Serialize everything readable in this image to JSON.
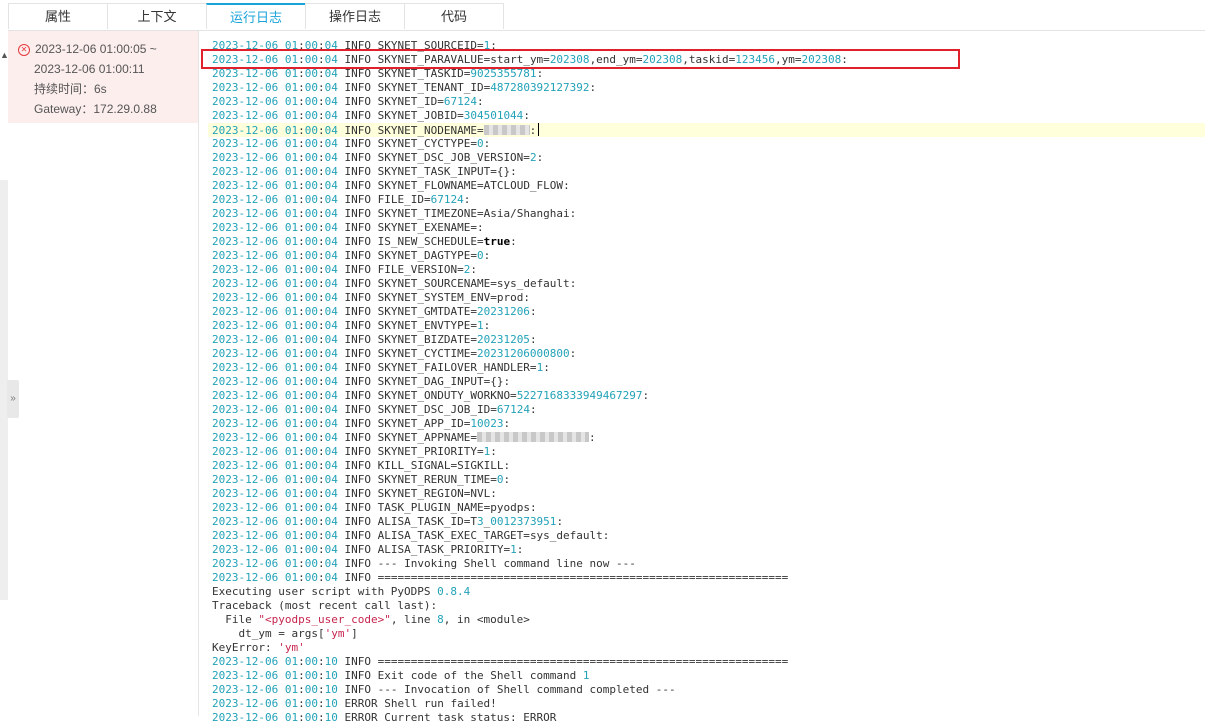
{
  "tabs": [
    "属性",
    "上下文",
    "运行日志",
    "操作日志",
    "代码"
  ],
  "active_tab": "运行日志",
  "run": {
    "start": "2023-12-06 01:00:05 ~",
    "end": "2023-12-06 01:00:11",
    "duration": "持续时间：6s",
    "gateway": "Gateway：172.29.0.88",
    "status_icon": "error-circle-icon"
  },
  "collapse_label": "»",
  "colors": {
    "accent": "#1aa3d9",
    "highlight_box": "#e0202a",
    "timestamp": "#22a2b8",
    "run_panel_bg": "#fdeeee"
  },
  "log_lines": [
    {
      "ts": "2023-12-06 01:00:04",
      "lvl": "INFO",
      "key": "SKYNET_SOURCEID",
      "val": "1"
    },
    {
      "ts": "2023-12-06 01:00:04",
      "lvl": "INFO",
      "key": "SKYNET_PARAVALUE",
      "val": "start_ym=202308,end_ym=202308,taskid=123456,ym=202308"
    },
    {
      "ts": "2023-12-06 01:00:04",
      "lvl": "INFO",
      "key": "SKYNET_TASKID",
      "val": "9025355781"
    },
    {
      "ts": "2023-12-06 01:00:04",
      "lvl": "INFO",
      "key": "SKYNET_TENANT_ID",
      "val": "487280392127392"
    },
    {
      "ts": "2023-12-06 01:00:04",
      "lvl": "INFO",
      "key": "SKYNET_ID",
      "val": "67124"
    },
    {
      "ts": "2023-12-06 01:00:04",
      "lvl": "INFO",
      "key": "SKYNET_JOBID",
      "val": "304501044"
    },
    {
      "ts": "2023-12-06 01:00:04",
      "lvl": "INFO",
      "key": "SKYNET_NODENAME",
      "val": "",
      "redacted": true
    },
    {
      "ts": "2023-12-06 01:00:04",
      "lvl": "INFO",
      "key": "SKYNET_CYCTYPE",
      "val": "0"
    },
    {
      "ts": "2023-12-06 01:00:04",
      "lvl": "INFO",
      "key": "SKYNET_DSC_JOB_VERSION",
      "val": "2"
    },
    {
      "ts": "2023-12-06 01:00:04",
      "lvl": "INFO",
      "key": "SKYNET_TASK_INPUT",
      "val": "{}"
    },
    {
      "ts": "2023-12-06 01:00:04",
      "lvl": "INFO",
      "key": "SKYNET_FLOWNAME",
      "val": "ATCLOUD_FLOW"
    },
    {
      "ts": "2023-12-06 01:00:04",
      "lvl": "INFO",
      "key": "FILE_ID",
      "val": "67124"
    },
    {
      "ts": "2023-12-06 01:00:04",
      "lvl": "INFO",
      "key": "SKYNET_TIMEZONE",
      "val": "Asia/Shanghai"
    },
    {
      "ts": "2023-12-06 01:00:04",
      "lvl": "INFO",
      "key": "SKYNET_EXENAME",
      "val": ""
    },
    {
      "ts": "2023-12-06 01:00:04",
      "lvl": "INFO",
      "key": "IS_NEW_SCHEDULE",
      "val": "true"
    },
    {
      "ts": "2023-12-06 01:00:04",
      "lvl": "INFO",
      "key": "SKYNET_DAGTYPE",
      "val": "0"
    },
    {
      "ts": "2023-12-06 01:00:04",
      "lvl": "INFO",
      "key": "FILE_VERSION",
      "val": "2"
    },
    {
      "ts": "2023-12-06 01:00:04",
      "lvl": "INFO",
      "key": "SKYNET_SOURCENAME",
      "val": "sys_default"
    },
    {
      "ts": "2023-12-06 01:00:04",
      "lvl": "INFO",
      "key": "SKYNET_SYSTEM_ENV",
      "val": "prod"
    },
    {
      "ts": "2023-12-06 01:00:04",
      "lvl": "INFO",
      "key": "SKYNET_GMTDATE",
      "val": "20231206"
    },
    {
      "ts": "2023-12-06 01:00:04",
      "lvl": "INFO",
      "key": "SKYNET_ENVTYPE",
      "val": "1"
    },
    {
      "ts": "2023-12-06 01:00:04",
      "lvl": "INFO",
      "key": "SKYNET_BIZDATE",
      "val": "20231205"
    },
    {
      "ts": "2023-12-06 01:00:04",
      "lvl": "INFO",
      "key": "SKYNET_CYCTIME",
      "val": "20231206000800"
    },
    {
      "ts": "2023-12-06 01:00:04",
      "lvl": "INFO",
      "key": "SKYNET_FAILOVER_HANDLER",
      "val": "1"
    },
    {
      "ts": "2023-12-06 01:00:04",
      "lvl": "INFO",
      "key": "SKYNET_DAG_INPUT",
      "val": "{}"
    },
    {
      "ts": "2023-12-06 01:00:04",
      "lvl": "INFO",
      "key": "SKYNET_ONDUTY_WORKNO",
      "val": "5227168333949467297"
    },
    {
      "ts": "2023-12-06 01:00:04",
      "lvl": "INFO",
      "key": "SKYNET_DSC_JOB_ID",
      "val": "67124"
    },
    {
      "ts": "2023-12-06 01:00:04",
      "lvl": "INFO",
      "key": "SKYNET_APP_ID",
      "val": "10023"
    },
    {
      "ts": "2023-12-06 01:00:04",
      "lvl": "INFO",
      "key": "SKYNET_APPNAME",
      "val": "",
      "redacted": true
    },
    {
      "ts": "2023-12-06 01:00:04",
      "lvl": "INFO",
      "key": "SKYNET_PRIORITY",
      "val": "1"
    },
    {
      "ts": "2023-12-06 01:00:04",
      "lvl": "INFO",
      "key": "KILL_SIGNAL",
      "val": "SIGKILL"
    },
    {
      "ts": "2023-12-06 01:00:04",
      "lvl": "INFO",
      "key": "SKYNET_RERUN_TIME",
      "val": "0"
    },
    {
      "ts": "2023-12-06 01:00:04",
      "lvl": "INFO",
      "key": "SKYNET_REGION",
      "val": "NVL"
    },
    {
      "ts": "2023-12-06 01:00:04",
      "lvl": "INFO",
      "key": "TASK_PLUGIN_NAME",
      "val": "pyodps"
    },
    {
      "ts": "2023-12-06 01:00:04",
      "lvl": "INFO",
      "key": "ALISA_TASK_ID",
      "val": "T3_0012373951"
    },
    {
      "ts": "2023-12-06 01:00:04",
      "lvl": "INFO",
      "key": "ALISA_TASK_EXEC_TARGET",
      "val": "sys_default"
    },
    {
      "ts": "2023-12-06 01:00:04",
      "lvl": "INFO",
      "key": "ALISA_TASK_PRIORITY",
      "val": "1"
    },
    {
      "ts": "2023-12-06 01:00:04",
      "lvl": "INFO",
      "text": "--- Invoking Shell command line now ---"
    },
    {
      "ts": "2023-12-06 01:00:04",
      "lvl": "INFO",
      "text": "=============================================================="
    },
    {
      "raw": "Executing user script with PyODPS ",
      "rawnum": "0.8.4"
    },
    {
      "raw": "Traceback (most recent call last):"
    },
    {
      "raw": "  File ",
      "rawstr": "\"<pyodps_user_code>\"",
      "raw2": ", line ",
      "rawnum": "8",
      "raw3": ", in <module>"
    },
    {
      "raw": "    dt_ym = args[",
      "rawstr": "'ym'",
      "raw2": "]"
    },
    {
      "raw": "KeyError: ",
      "rawstr": "'ym'"
    },
    {
      "ts": "2023-12-06 01:00:10",
      "lvl": "INFO",
      "text": "=============================================================="
    },
    {
      "ts": "2023-12-06 01:00:10",
      "lvl": "INFO",
      "text": "Exit code of the Shell command ",
      "num": "1"
    },
    {
      "ts": "2023-12-06 01:00:10",
      "lvl": "INFO",
      "text": "--- Invocation of Shell command completed ---"
    },
    {
      "ts": "2023-12-06 01:00:10",
      "lvl": "ERROR",
      "text": "Shell run failed!"
    },
    {
      "ts": "2023-12-06 01:00:10",
      "lvl": "ERROR",
      "text": "Current task status: ERROR"
    }
  ]
}
